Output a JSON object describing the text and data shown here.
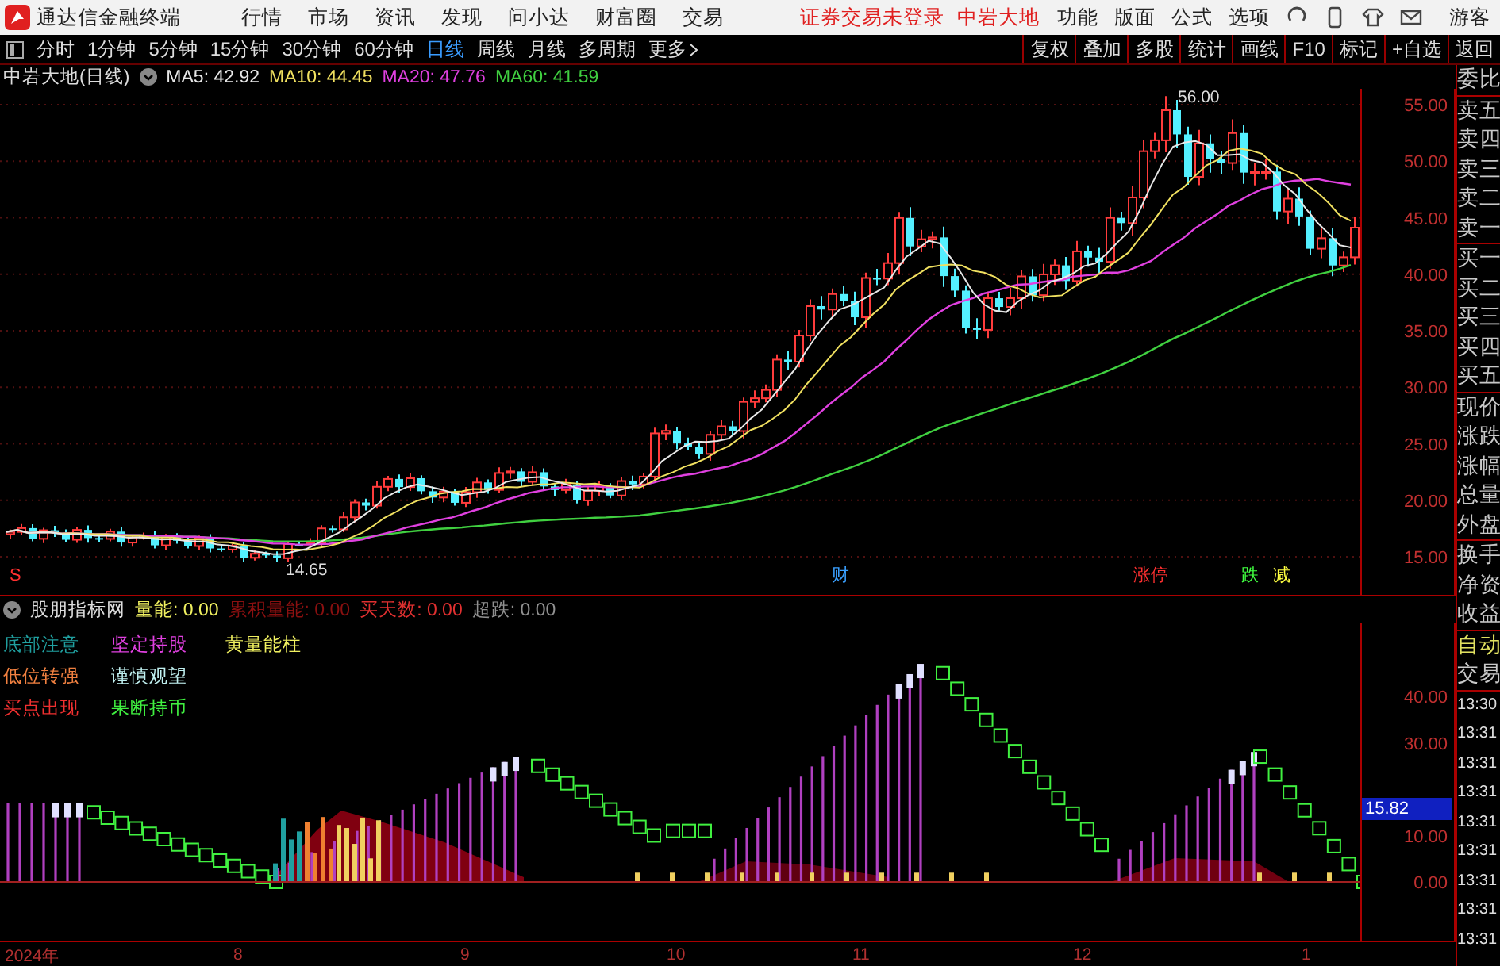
{
  "app_title": "通达信金融终端",
  "menu": [
    "行情",
    "市场",
    "资讯",
    "发现",
    "问小达",
    "财富圈",
    "交易"
  ],
  "login_status": "证券交易未登录",
  "stock_name": "中岩大地",
  "tools": [
    "功能",
    "版面",
    "公式",
    "选项"
  ],
  "user": "游客",
  "periods": [
    {
      "label": "分时",
      "selected": false
    },
    {
      "label": "1分钟",
      "selected": false
    },
    {
      "label": "5分钟",
      "selected": false
    },
    {
      "label": "15分钟",
      "selected": false
    },
    {
      "label": "30分钟",
      "selected": false
    },
    {
      "label": "60分钟",
      "selected": false
    },
    {
      "label": "日线",
      "selected": true
    },
    {
      "label": "周线",
      "selected": false
    },
    {
      "label": "月线",
      "selected": false
    },
    {
      "label": "多周期",
      "selected": false
    }
  ],
  "more": "更多",
  "actions": [
    "复权",
    "叠加",
    "多股",
    "统计",
    "画线",
    "F10",
    "标记",
    "+自选",
    "返回"
  ],
  "price_chart": {
    "title": "中岩大地(日线)",
    "ma": [
      {
        "label": "MA5: 42.92",
        "color": "#e8e8e8"
      },
      {
        "label": "MA10: 44.45",
        "color": "#f0e060"
      },
      {
        "label": "MA20: 47.76",
        "color": "#e040e0"
      },
      {
        "label": "MA60: 41.59",
        "color": "#40d040"
      }
    ],
    "y_labels": [
      "55.00",
      "50.00",
      "45.00",
      "40.00",
      "35.00",
      "30.00",
      "25.00",
      "20.00",
      "15.00"
    ],
    "high_marker": "56.00",
    "low_marker": "14.65",
    "events": [
      {
        "text": "S",
        "color": "#ff3030"
      },
      {
        "text": "财",
        "color": "#3aa0ff"
      },
      {
        "text": "涨停",
        "color": "#ff3030"
      },
      {
        "text": "跌",
        "color": "#40ff40"
      },
      {
        "text": "减",
        "color": "#ffff40"
      }
    ]
  },
  "indicator": {
    "name": "股朋指标网",
    "readouts": [
      {
        "text": "量能: 0.00",
        "color": "#f0f060"
      },
      {
        "text": "累积量能: 0.00",
        "color": "#8a1010"
      },
      {
        "text": "买天数: 0.00",
        "color": "#e03030"
      },
      {
        "text": "超跌: 0.00",
        "color": "#909090"
      }
    ],
    "legend": [
      {
        "text": "底部注意",
        "color": "#20a0a0"
      },
      {
        "text": "坚定持股",
        "color": "#e040e0"
      },
      {
        "text": "黄量能柱",
        "color": "#f0f060"
      },
      {
        "text": "低位转强",
        "color": "#f08040"
      },
      {
        "text": "谨慎观望",
        "color": "#c0f0f0"
      },
      {
        "text": "买点出现",
        "color": "#f03030"
      },
      {
        "text": "果断持币",
        "color": "#40f040"
      }
    ],
    "y_labels": [
      "40.00",
      "30.00",
      "10.00",
      "0.00"
    ],
    "current_value": "15.82"
  },
  "dates": [
    "2024年",
    "8",
    "9",
    "10",
    "11",
    "12",
    "1"
  ],
  "info_panel": {
    "labels": [
      "委比",
      "卖五",
      "卖四",
      "卖三",
      "卖二",
      "卖一",
      "买一",
      "买二",
      "买三",
      "买四",
      "买五",
      "现价",
      "涨跌",
      "涨幅",
      "总量",
      "外盘",
      "换手",
      "净资",
      "收益"
    ],
    "auto": "自动",
    "trade": "交易",
    "times": [
      "13:30",
      "13:31",
      "13:31",
      "13:31",
      "13:31",
      "13:31",
      "13:31",
      "13:31",
      "13:31"
    ]
  }
}
